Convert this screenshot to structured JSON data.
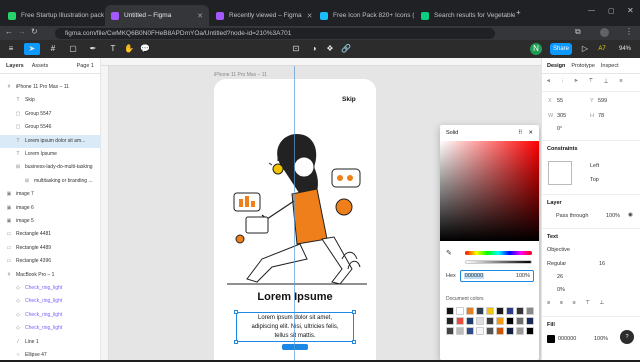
{
  "tabs": [
    {
      "label": "Free Startup Illustration pack fro",
      "color": "#25d366"
    },
    {
      "label": "Untitled – Figma",
      "color": "#a259ff"
    },
    {
      "label": "Recently viewed – Figma",
      "color": "#a259ff"
    },
    {
      "label": "Free Icon Pack 820+ Icons (Comm",
      "color": "#1abcfe"
    },
    {
      "label": "Search results for Vegetable – Fre",
      "color": "#0acf83"
    }
  ],
  "url": "figma.com/file/CwMKQ6B0N0FHeB8APDmYOa/Untitled?node-id=210%3A701",
  "toolbar": {
    "share_label": "Share",
    "zoom": "94%",
    "avatar_letter": "N"
  },
  "left_panel": {
    "tab_layers": "Layers",
    "tab_assets": "Assets",
    "page": "Page 1",
    "layers": [
      {
        "label": "iPhone 11 Pro Max – 11",
        "icon": "#",
        "indent": 0,
        "sel": false,
        "comp": false
      },
      {
        "label": "Skip",
        "icon": "T",
        "indent": 1,
        "sel": false,
        "comp": false
      },
      {
        "label": "Group 5547",
        "icon": "▢",
        "indent": 1,
        "sel": false,
        "comp": false
      },
      {
        "label": "Group 5546",
        "icon": "▢",
        "indent": 1,
        "sel": false,
        "comp": false
      },
      {
        "label": "Lorem ipsum dolor sit am...",
        "icon": "T",
        "indent": 1,
        "sel": true,
        "comp": false
      },
      {
        "label": "Lorem Ipsume",
        "icon": "T",
        "indent": 1,
        "sel": false,
        "comp": false
      },
      {
        "label": "business-lady-do-multi-tasking",
        "icon": "⊞",
        "indent": 1,
        "sel": false,
        "comp": false
      },
      {
        "label": "multitasking or branding ...",
        "icon": "⊞",
        "indent": 2,
        "sel": false,
        "comp": false
      },
      {
        "label": "image 7",
        "icon": "▣",
        "indent": 0,
        "sel": false,
        "comp": false
      },
      {
        "label": "image 6",
        "icon": "▣",
        "indent": 0,
        "sel": false,
        "comp": false
      },
      {
        "label": "image 5",
        "icon": "▣",
        "indent": 0,
        "sel": false,
        "comp": false
      },
      {
        "label": "Rectangle 4481",
        "icon": "▭",
        "indent": 0,
        "sel": false,
        "comp": false
      },
      {
        "label": "Rectangle 4489",
        "icon": "▭",
        "indent": 0,
        "sel": false,
        "comp": false
      },
      {
        "label": "Rectangle 4396",
        "icon": "▭",
        "indent": 0,
        "sel": false,
        "comp": false
      },
      {
        "label": "MacBook Pro – 1",
        "icon": "#",
        "indent": 0,
        "sel": false,
        "comp": false
      },
      {
        "label": "Check_ring_light",
        "icon": "◇",
        "indent": 1,
        "sel": false,
        "comp": true
      },
      {
        "label": "Check_ring_light",
        "icon": "◇",
        "indent": 1,
        "sel": false,
        "comp": true
      },
      {
        "label": "Check_ring_light",
        "icon": "◇",
        "indent": 1,
        "sel": false,
        "comp": true
      },
      {
        "label": "Check_ring_light",
        "icon": "◇",
        "indent": 1,
        "sel": false,
        "comp": true
      },
      {
        "label": "Line 1",
        "icon": "/",
        "indent": 1,
        "sel": false,
        "comp": false
      },
      {
        "label": "Ellipse 47",
        "icon": "○",
        "indent": 1,
        "sel": false,
        "comp": false
      }
    ]
  },
  "canvas": {
    "frame_label": "iPhone 11 Pro Max – 11",
    "skip": "Skip",
    "headline": "Lorem Ipsume",
    "body_lines": [
      "Lorem ipsum dolor sit amet,",
      "adipiscing elit. Nisi, ultricies felis,",
      "tellus sit mattis."
    ]
  },
  "picker": {
    "mode": "Solid",
    "hex_label": "Hex",
    "hex_value": "000000",
    "opacity": "100%",
    "doc_colors_label": "Document colors",
    "swatches": [
      "#111111",
      "#ffffff",
      "#e67e22",
      "#2c3e50",
      "#f1c40f",
      "#1a1a1a",
      "#2d3a8c",
      "#333333",
      "#888888",
      "#222222",
      "#e74c3c",
      "#1d3b6f",
      "#dddddd",
      "#3a3a3a",
      "#f39c12",
      "#000000",
      "#6c6c6c",
      "#1b2a5a",
      "#444444",
      "#bbbbbb",
      "#2e4a8a",
      "#f5f5f5",
      "#555555",
      "#cc5500",
      "#102040",
      "#999999",
      "#000000"
    ]
  },
  "right_panel": {
    "tabs": [
      "Design",
      "Prototype",
      "Inspect"
    ],
    "x": "55",
    "y": "599",
    "w": "305",
    "h": "78",
    "rotation": "0°",
    "constraints_label": "Constraints",
    "c_h": "Left",
    "c_v": "Top",
    "layer_label": "Layer",
    "blend": "Pass through",
    "layer_opacity": "100%",
    "text_label": "Text",
    "font": "Objective",
    "weight": "Regular",
    "size": "16",
    "line_height": "26",
    "letter": "0%",
    "fill_label": "Fill",
    "fill_hex": "000000",
    "fill_opacity": "100%"
  }
}
